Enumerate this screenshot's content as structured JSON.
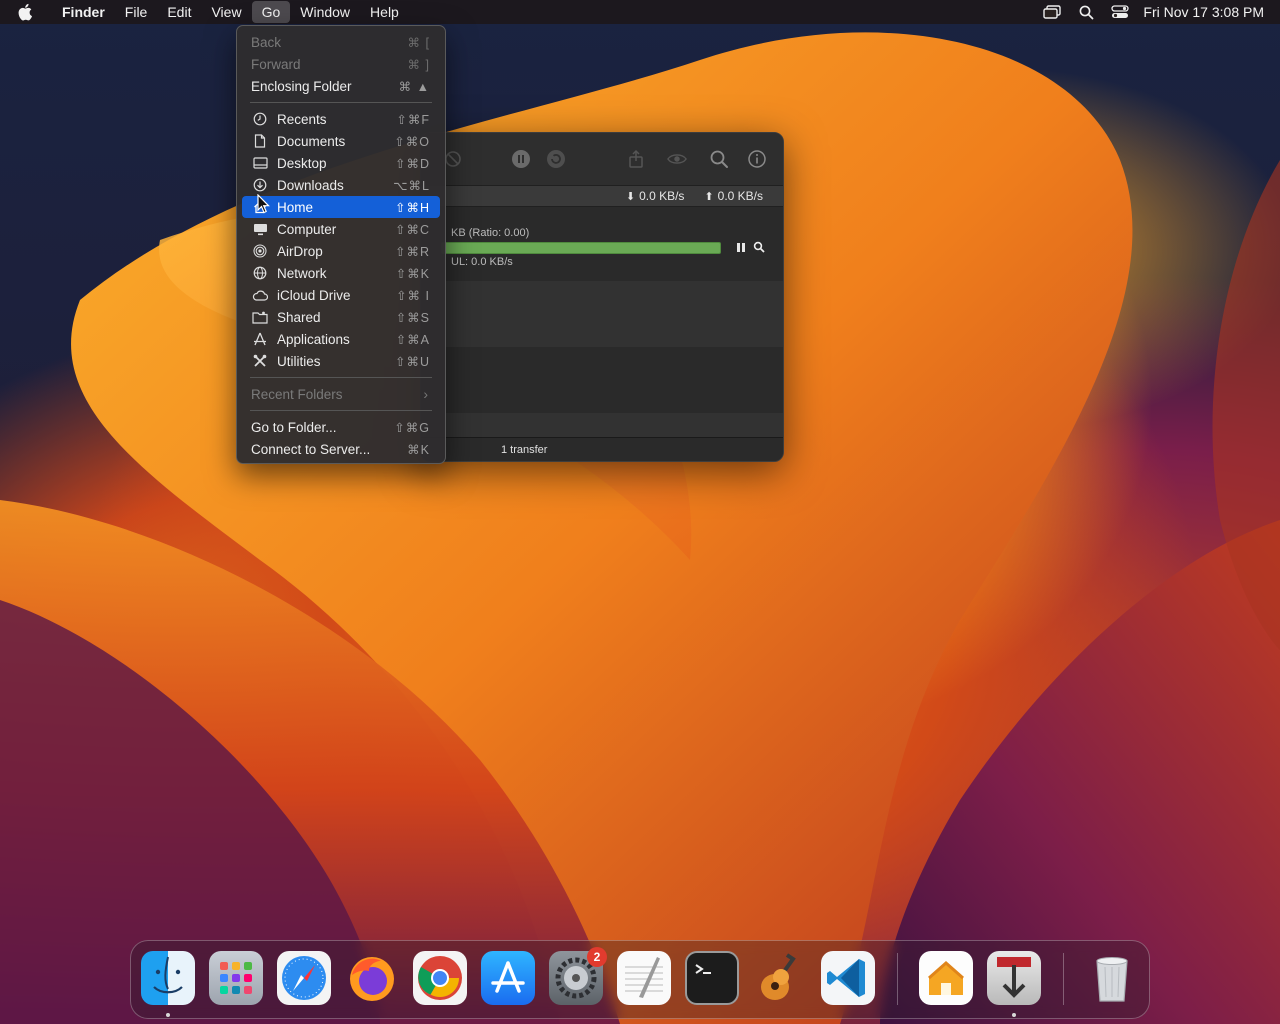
{
  "menubar": {
    "app_name": "Finder",
    "menus": [
      "File",
      "Edit",
      "View",
      "Go",
      "Window",
      "Help"
    ],
    "open_menu": "Go",
    "status_icons": [
      "screen-mirroring-icon",
      "spotlight-search-icon",
      "control-center-icon"
    ],
    "clock": "Fri Nov 17  3:08 PM"
  },
  "go_menu": {
    "items": [
      {
        "label": "Back",
        "shortcut": "⌘ [",
        "disabled": true
      },
      {
        "label": "Forward",
        "shortcut": "⌘ ]",
        "disabled": true
      },
      {
        "label": "Enclosing Folder",
        "shortcut": "⌘ ▲",
        "disabled": false
      }
    ],
    "places": [
      {
        "label": "Recents",
        "shortcut": "⇧⌘F",
        "icon": "clock-icon"
      },
      {
        "label": "Documents",
        "shortcut": "⇧⌘O",
        "icon": "document-icon"
      },
      {
        "label": "Desktop",
        "shortcut": "⇧⌘D",
        "icon": "desktop-icon"
      },
      {
        "label": "Downloads",
        "shortcut": "⌥⌘L",
        "icon": "download-icon"
      },
      {
        "label": "Home",
        "shortcut": "⇧⌘H",
        "icon": "home-icon",
        "selected": true
      },
      {
        "label": "Computer",
        "shortcut": "⇧⌘C",
        "icon": "computer-icon"
      },
      {
        "label": "AirDrop",
        "shortcut": "⇧⌘R",
        "icon": "airdrop-icon"
      },
      {
        "label": "Network",
        "shortcut": "⇧⌘K",
        "icon": "network-globe-icon"
      },
      {
        "label": "iCloud Drive",
        "shortcut": "⇧⌘ I",
        "icon": "cloud-icon"
      },
      {
        "label": "Shared",
        "shortcut": "⇧⌘S",
        "icon": "shared-folder-icon"
      },
      {
        "label": "Applications",
        "shortcut": "⇧⌘A",
        "icon": "applications-icon"
      },
      {
        "label": "Utilities",
        "shortcut": "⇧⌘U",
        "icon": "utilities-icon"
      }
    ],
    "recent_folders": {
      "label": "Recent Folders",
      "disabled": true
    },
    "bottom": [
      {
        "label": "Go to Folder...",
        "shortcut": "⇧⌘G"
      },
      {
        "label": "Connect to Server...",
        "shortcut": "⌘K"
      }
    ]
  },
  "transfer_window": {
    "download_speed": "0.0 KB/s",
    "upload_speed": "0.0 KB/s",
    "torrent_info": "KB (Ratio: 0.00)",
    "torrent_ul": "UL: 0.0 KB/s",
    "progress": 1.0,
    "footer": "1 transfer"
  },
  "dock": {
    "apps": [
      {
        "name": "Finder",
        "running": true
      },
      {
        "name": "Launchpad"
      },
      {
        "name": "Safari"
      },
      {
        "name": "Firefox"
      },
      {
        "name": "Chrome"
      },
      {
        "name": "App Store"
      },
      {
        "name": "System Settings",
        "badge": "2"
      },
      {
        "name": "TextEdit"
      },
      {
        "name": "Terminal"
      },
      {
        "name": "GarageBand"
      },
      {
        "name": "Visual Studio Code"
      },
      {
        "name": "Home"
      },
      {
        "name": "Transmission",
        "running": true
      },
      {
        "name": "Trash"
      }
    ],
    "colors": {
      "selection": "#1460d8",
      "badge": "#e23b2e",
      "progress": "#6aaa55"
    }
  }
}
